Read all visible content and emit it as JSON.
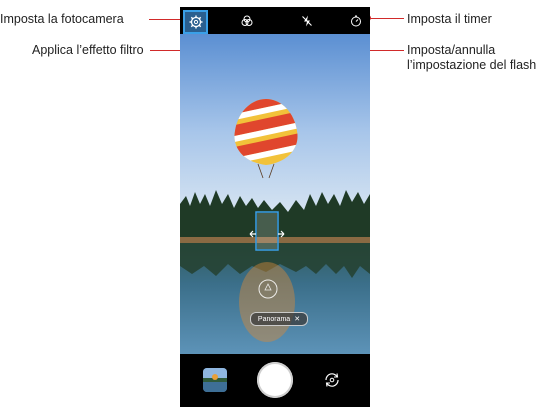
{
  "callouts": {
    "camera_settings": "Imposta la fotocamera",
    "filter_effect": "Applica l’effetto filtro",
    "timer": "Imposta il timer",
    "flash_line1": "Imposta/annulla",
    "flash_line2": "l’impostazione del flash"
  },
  "camera": {
    "top_icons": [
      "gear-icon",
      "filter-icon",
      "flash-off-icon",
      "timer-icon"
    ],
    "mode_chip": {
      "label": "Panorama",
      "close": "✕"
    },
    "bottom_icons": [
      "gallery-thumbnail",
      "shutter-button",
      "switch-camera-icon"
    ]
  },
  "colors": {
    "callout_line": "#d12a2a",
    "highlight_box": "#3aa0e8"
  }
}
